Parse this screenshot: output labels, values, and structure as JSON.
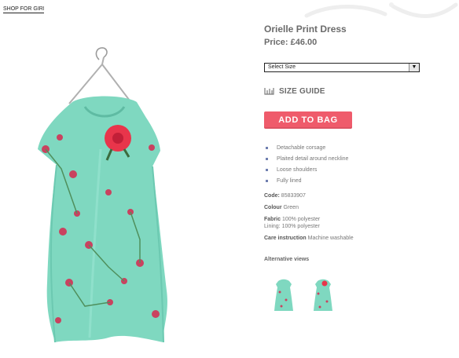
{
  "header": {
    "top_link": "SHOP FOR GIRLS"
  },
  "product": {
    "title": "Orielle Print Dress",
    "price_label": "Price:",
    "price": "£46.00",
    "size_select": "Select Size",
    "size_guide": "SIZE GUIDE",
    "add_to_bag": "ADD TO BAG",
    "features": [
      "Detachable corsage",
      "Plaited detail around neckline",
      "Loose shoulders",
      "Fully lined"
    ],
    "code_label": "Code:",
    "code": "85833907",
    "colour_label": "Colour",
    "colour": "Green",
    "fabric_label": "Fabric",
    "fabric_lines": [
      "100% polyester",
      "Lining: 100% polyester"
    ],
    "care_label": "Care instruction",
    "care": "Machine washable",
    "alt_views_title": "Alternative views"
  },
  "colors": {
    "dress": "#7fd8c0",
    "flower": "#e8354b",
    "button": "#ef5b6b"
  },
  "icons": {
    "size_guide": "ruler-icon",
    "dropdown": "chevron-down-icon"
  }
}
